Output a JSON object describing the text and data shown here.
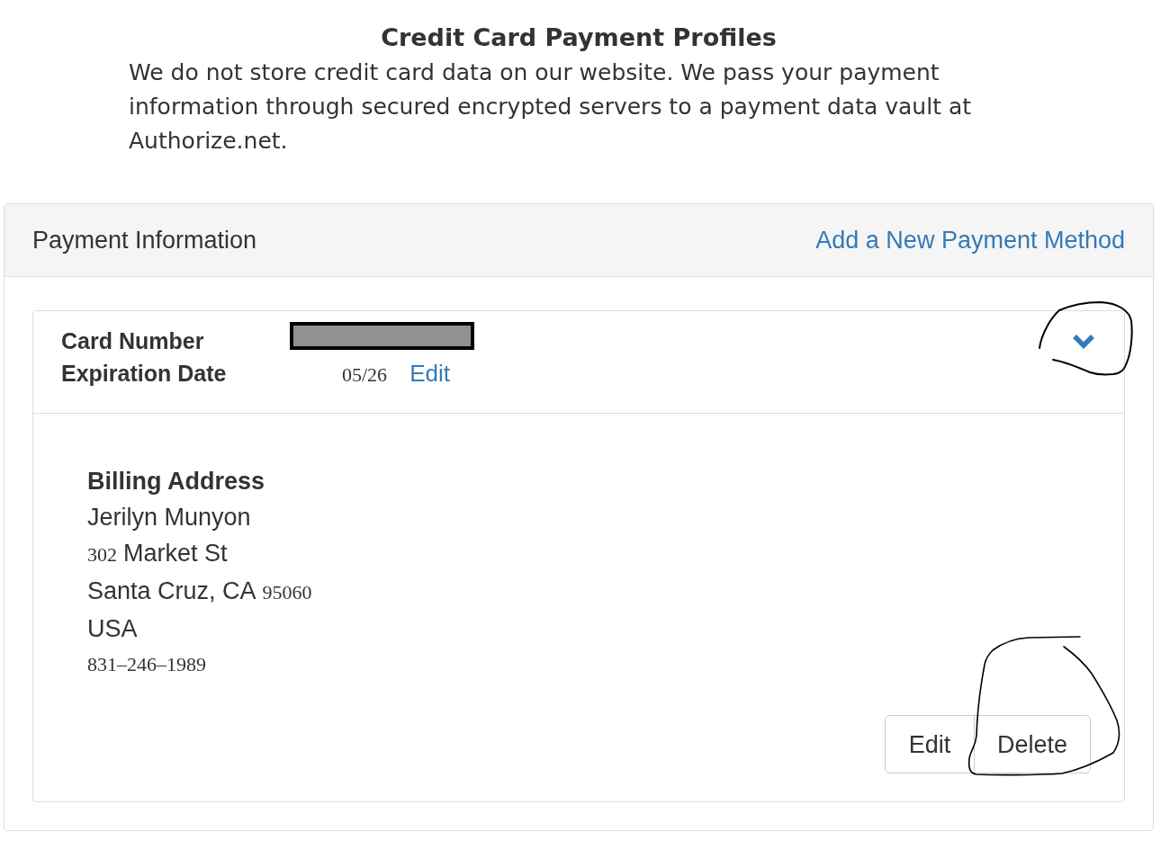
{
  "page": {
    "title": "Credit Card Payment Profiles",
    "notice": "We do not store credit card data on our website. We pass your payment information through secured encrypted servers to a payment data vault at Authorize.net."
  },
  "panel": {
    "title": "Payment Information",
    "add_link": "Add a New Payment Method"
  },
  "cards": [
    {
      "expanded": true,
      "fields": [
        {
          "label": "Card Number",
          "redacted": true
        },
        {
          "label": "Expiration Date",
          "value": "05/26",
          "action": "Edit"
        }
      ],
      "billing": {
        "heading": "Billing Address",
        "name": "Jerilyn Munyon",
        "street_number": "302",
        "street": "Market St",
        "city_state": "Santa Cruz, CA",
        "zip": "95060",
        "country": "USA",
        "phone": "831–246–1989"
      },
      "buttons": [
        "Edit",
        "Delete"
      ]
    }
  ]
}
